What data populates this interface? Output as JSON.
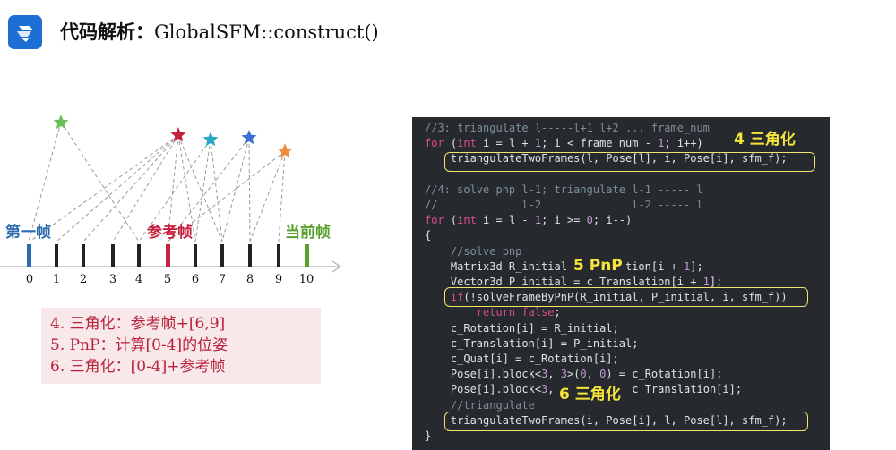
{
  "header": {
    "title_cn": "代码解析：",
    "title_code": "GlobalSFM::construct()"
  },
  "diagram": {
    "first_frame_label": "第一帧",
    "reference_frame_label": "参考帧",
    "current_frame_label": "当前帧",
    "ticks": [
      "0",
      "1",
      "2",
      "3",
      "4",
      "5",
      "6",
      "7",
      "8",
      "9",
      "10"
    ],
    "colors": {
      "first": "#2b6cb0",
      "reference": "#c8203f",
      "current": "#5aa02c",
      "frame_bar": "#222222",
      "star_green": "#6bbf59",
      "star_red": "#c8203f",
      "star_teal": "#2aa6c8",
      "star_blue": "#3a6fd1",
      "star_orange": "#f08a3c"
    }
  },
  "info": {
    "lines": [
      "4. 三角化：参考帧+[6,9]",
      "5. PnP：计算[0-4]的位姿",
      "6. 三角化：[0-4]+参考帧"
    ]
  },
  "code": {
    "lines": [
      {
        "t": "com",
        "s": "//3: triangulate l-----l+1 l+2 ... frame_num"
      },
      {
        "t": "mix",
        "s": "for (int i = l + 1; i < frame_num - 1; i++)"
      },
      {
        "t": "plain",
        "s": "    triangulateTwoFrames(l, Pose[l], i, Pose[i], sfm_f);"
      },
      {
        "t": "plain",
        "s": ""
      },
      {
        "t": "com",
        "s": "//4: solve pnp l-1; triangulate l-1 ----- l"
      },
      {
        "t": "com",
        "s": "//             l-2              l-2 ----- l"
      },
      {
        "t": "mix",
        "s": "for (int i = l - 1; i >= 0; i--)"
      },
      {
        "t": "plain",
        "s": "{"
      },
      {
        "t": "com",
        "s": "    //solve pnp"
      },
      {
        "t": "plain",
        "s": "    Matrix3d R_initial = c_Rotation[i + 1];"
      },
      {
        "t": "plain",
        "s": "    Vector3d P_initial = c_Translation[i + 1];"
      },
      {
        "t": "plain",
        "s": "    if(!solveFrameByPnP(R_initial, P_initial, i, sfm_f))"
      },
      {
        "t": "plain",
        "s": "        return false;"
      },
      {
        "t": "plain",
        "s": "    c_Rotation[i] = R_initial;"
      },
      {
        "t": "plain",
        "s": "    c_Translation[i] = P_initial;"
      },
      {
        "t": "plain",
        "s": "    c_Quat[i] = c_Rotation[i];"
      },
      {
        "t": "plain",
        "s": "    Pose[i].block<3, 3>(0, 0) = c_Rotation[i];"
      },
      {
        "t": "plain",
        "s": "    Pose[i].block<3, 1>(0, 3) = c_Translation[i];"
      },
      {
        "t": "com",
        "s": "    //triangulate"
      },
      {
        "t": "plain",
        "s": "    triangulateTwoFrames(i, Pose[i], l, Pose[l], sfm_f);"
      },
      {
        "t": "plain",
        "s": "}"
      }
    ],
    "annotations": {
      "a4": "4 三角化",
      "a5": "5 PnP",
      "a6": "6 三角化"
    }
  }
}
